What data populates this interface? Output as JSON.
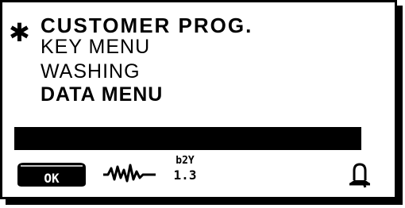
{
  "menu": {
    "marker": "✱",
    "items": [
      {
        "label": "CUSTOMER PROG.",
        "selected": true
      },
      {
        "label": "KEY MENU",
        "selected": false
      },
      {
        "label": "WASHING",
        "selected": false
      },
      {
        "label": "DATA MENU",
        "selected": false
      }
    ]
  },
  "progress": {
    "fill": 1.0
  },
  "status_bar": {
    "ok_label": "OK",
    "version_top": "b2Y",
    "version_number": "1.3",
    "icons": [
      "ok-button-icon",
      "waveform-icon",
      "version-icon",
      "bell-icon"
    ]
  }
}
